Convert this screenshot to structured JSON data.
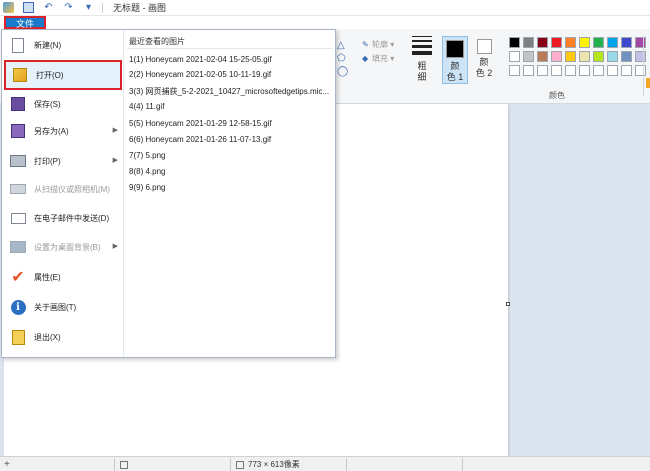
{
  "title_bar": {
    "title": "无标题 - 画图"
  },
  "ribbon": {
    "file_tab": "文件",
    "shape_outline": "轮廓",
    "shape_fill": "填充",
    "size_label_line1": "粗",
    "size_label_line2": "细",
    "color1_line1": "颜",
    "color1_line2": "色 1",
    "color2_line1": "颜",
    "color2_line2": "色 2",
    "palette_label": "颜色",
    "palette_colors": [
      [
        "#000000",
        "#7f7f7f",
        "#880015",
        "#ed1c24",
        "#ff7f27",
        "#fff200",
        "#22b14c",
        "#00a2e8",
        "#3f48cc",
        "#a349a4"
      ],
      [
        "#ffffff",
        "#c3c3c3",
        "#b97a57",
        "#ffaec9",
        "#ffc90e",
        "#efe4b0",
        "#b5e61d",
        "#99d9ea",
        "#7092be",
        "#c8bfe7"
      ],
      [
        "#ffffff",
        "#ffffff",
        "#ffffff",
        "#ffffff",
        "#ffffff",
        "#ffffff",
        "#ffffff",
        "#ffffff",
        "#ffffff",
        "#ffffff"
      ]
    ],
    "color1_value": "#000000",
    "color2_value": "#ffffff"
  },
  "file_menu": {
    "items": [
      {
        "label": "新建(N)",
        "icon": "new-document-icon"
      },
      {
        "label": "打开(O)",
        "icon": "open-icon"
      },
      {
        "label": "保存(S)",
        "icon": "save-icon"
      },
      {
        "label": "另存为(A)",
        "icon": "save-as-icon"
      },
      {
        "label": "打印(P)",
        "icon": "print-icon"
      },
      {
        "label": "从扫描仪或照相机(M)",
        "icon": "scanner-icon"
      },
      {
        "label": "在电子邮件中发送(D)",
        "icon": "email-icon"
      },
      {
        "label": "设置为桌面背景(B)",
        "icon": "desktop-background-icon"
      },
      {
        "label": "属性(E)",
        "icon": "properties-icon"
      },
      {
        "label": "关于画图(T)",
        "icon": "about-icon"
      },
      {
        "label": "退出(X)",
        "icon": "exit-icon"
      }
    ],
    "recent_title": "最近查看的图片",
    "recent_items": [
      "1(1)  Honeycam 2021-02-04 15-25-05.gif",
      "2(2)  Honeycam 2021-02-05 10-11-19.gif",
      "3(3)  网页捕获_5-2-2021_10427_microsoftedgetips.mic...",
      "4(4)  11.gif",
      "5(5)  Honeycam 2021-01-29 12-58-15.gif",
      "6(6)  Honeycam 2021-01-26 11-07-13.gif",
      "7(7)  5.png",
      "8(8)  4.png",
      "9(9)  6.png"
    ]
  },
  "status_bar": {
    "plus": "+",
    "canvas_size": "773 × 613像素"
  }
}
